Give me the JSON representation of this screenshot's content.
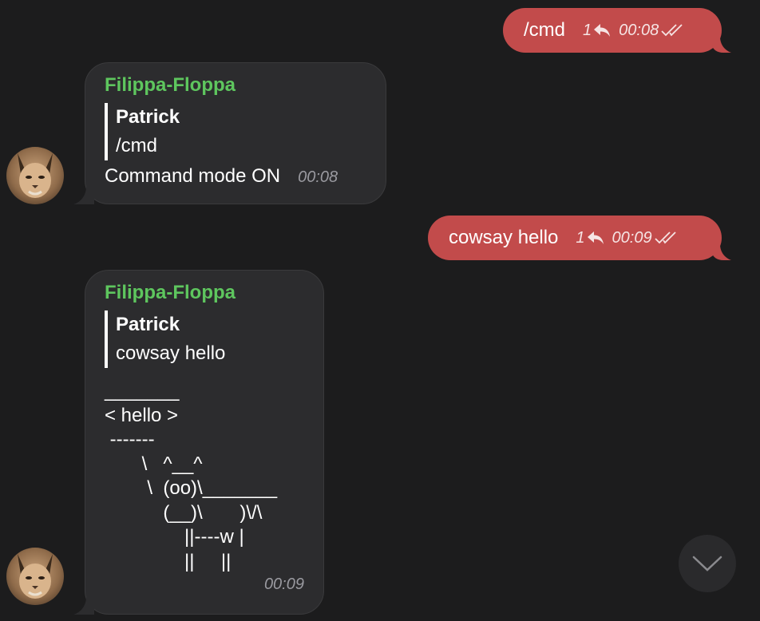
{
  "messages": [
    {
      "type": "outgoing",
      "text": "/cmd",
      "reply_count": "1",
      "time": "00:08"
    },
    {
      "type": "incoming",
      "sender": "Filippa-Floppa",
      "quote_name": "Patrick",
      "quote_text": "/cmd",
      "text": "Command mode ON",
      "time": "00:08"
    },
    {
      "type": "outgoing",
      "text": "cowsay hello",
      "reply_count": "1",
      "time": "00:09"
    },
    {
      "type": "incoming",
      "sender": "Filippa-Floppa",
      "quote_name": "Patrick",
      "quote_text": "cowsay hello",
      "ascii": "_______\n< hello >\n -------\n       \\   ^__^\n        \\  (oo)\\_______\n           (__)\\       )\\/\\\n               ||----w |\n               ||     ||",
      "time": "00:09"
    }
  ],
  "colors": {
    "background": "#1c1c1d",
    "outgoing_bubble": "#c24b4b",
    "incoming_bubble": "#2c2c2e",
    "sender_name": "#5ec65e",
    "time_incoming": "#9a9aa0"
  },
  "icons": {
    "reply": "reply-icon",
    "read": "double-check-icon",
    "scroll": "chevron-down-icon",
    "avatar": "caracal-avatar"
  }
}
